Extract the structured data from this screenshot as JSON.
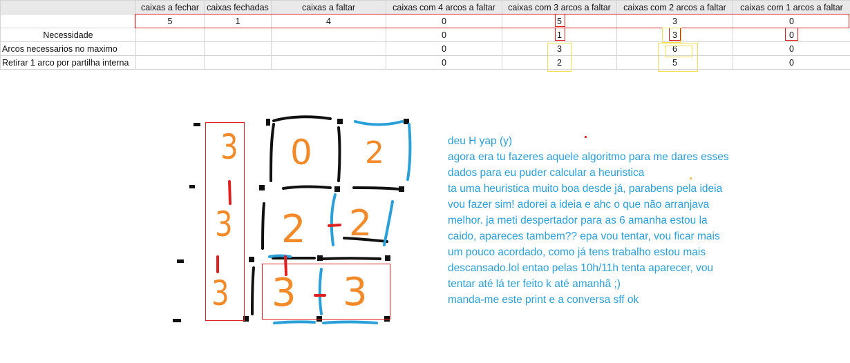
{
  "spreadsheet": {
    "headers": [
      "",
      "caixas a fechar",
      "caixas fechadas",
      "caixas a faltar",
      "caixas com 4 arcos a faltar",
      "caixas com 3 arcos a faltar",
      "caixas com 2 arcos a faltar",
      "caixas com 1 arcos a faltar"
    ],
    "rows": [
      [
        "",
        "5",
        "1",
        "4",
        "0",
        "5",
        "3",
        "0"
      ],
      [
        "Necessidade",
        "",
        "",
        "",
        "0",
        "1",
        "3",
        "0"
      ],
      [
        "Arcos necessarios no maximo",
        "",
        "",
        "",
        "0",
        "3",
        "6",
        "0"
      ],
      [
        "Retirar 1 arco por partilha interna",
        "",
        "",
        "",
        "0",
        "2",
        "5",
        "0"
      ]
    ]
  },
  "board": {
    "column_numbers": [
      "3",
      "3",
      "3"
    ],
    "cells": [
      "0",
      "2",
      "2",
      "2",
      "3",
      "3"
    ]
  },
  "chat": {
    "lines": [
      "deu H yap (y)",
      "agora era tu fazeres aquele algoritmo para me dares esses",
      "dados para eu puder calcular a heuristica",
      "ta uma heuristica muito boa desde já, parabens pela ideia",
      "vou fazer sim! adorei a ideia e ahc o que não arranjava",
      "melhor. ja meti despertador para as 6 amanha estou la",
      "caido, apareces tambem?? epa vou tentar, vou ficar mais",
      "um pouco acordado, como já tens trabalho estou mais",
      "descansado.lol entao pelas 10h/11h tenta aparecer, vou",
      "tentar até lá ter feito k até amanhã ;)",
      "manda-me este print e a conversa sff ok"
    ]
  },
  "colors": {
    "orange": "#f28a2a",
    "blue": "#2a9fd8",
    "red": "#e02020",
    "yellow": "#f2e050"
  }
}
